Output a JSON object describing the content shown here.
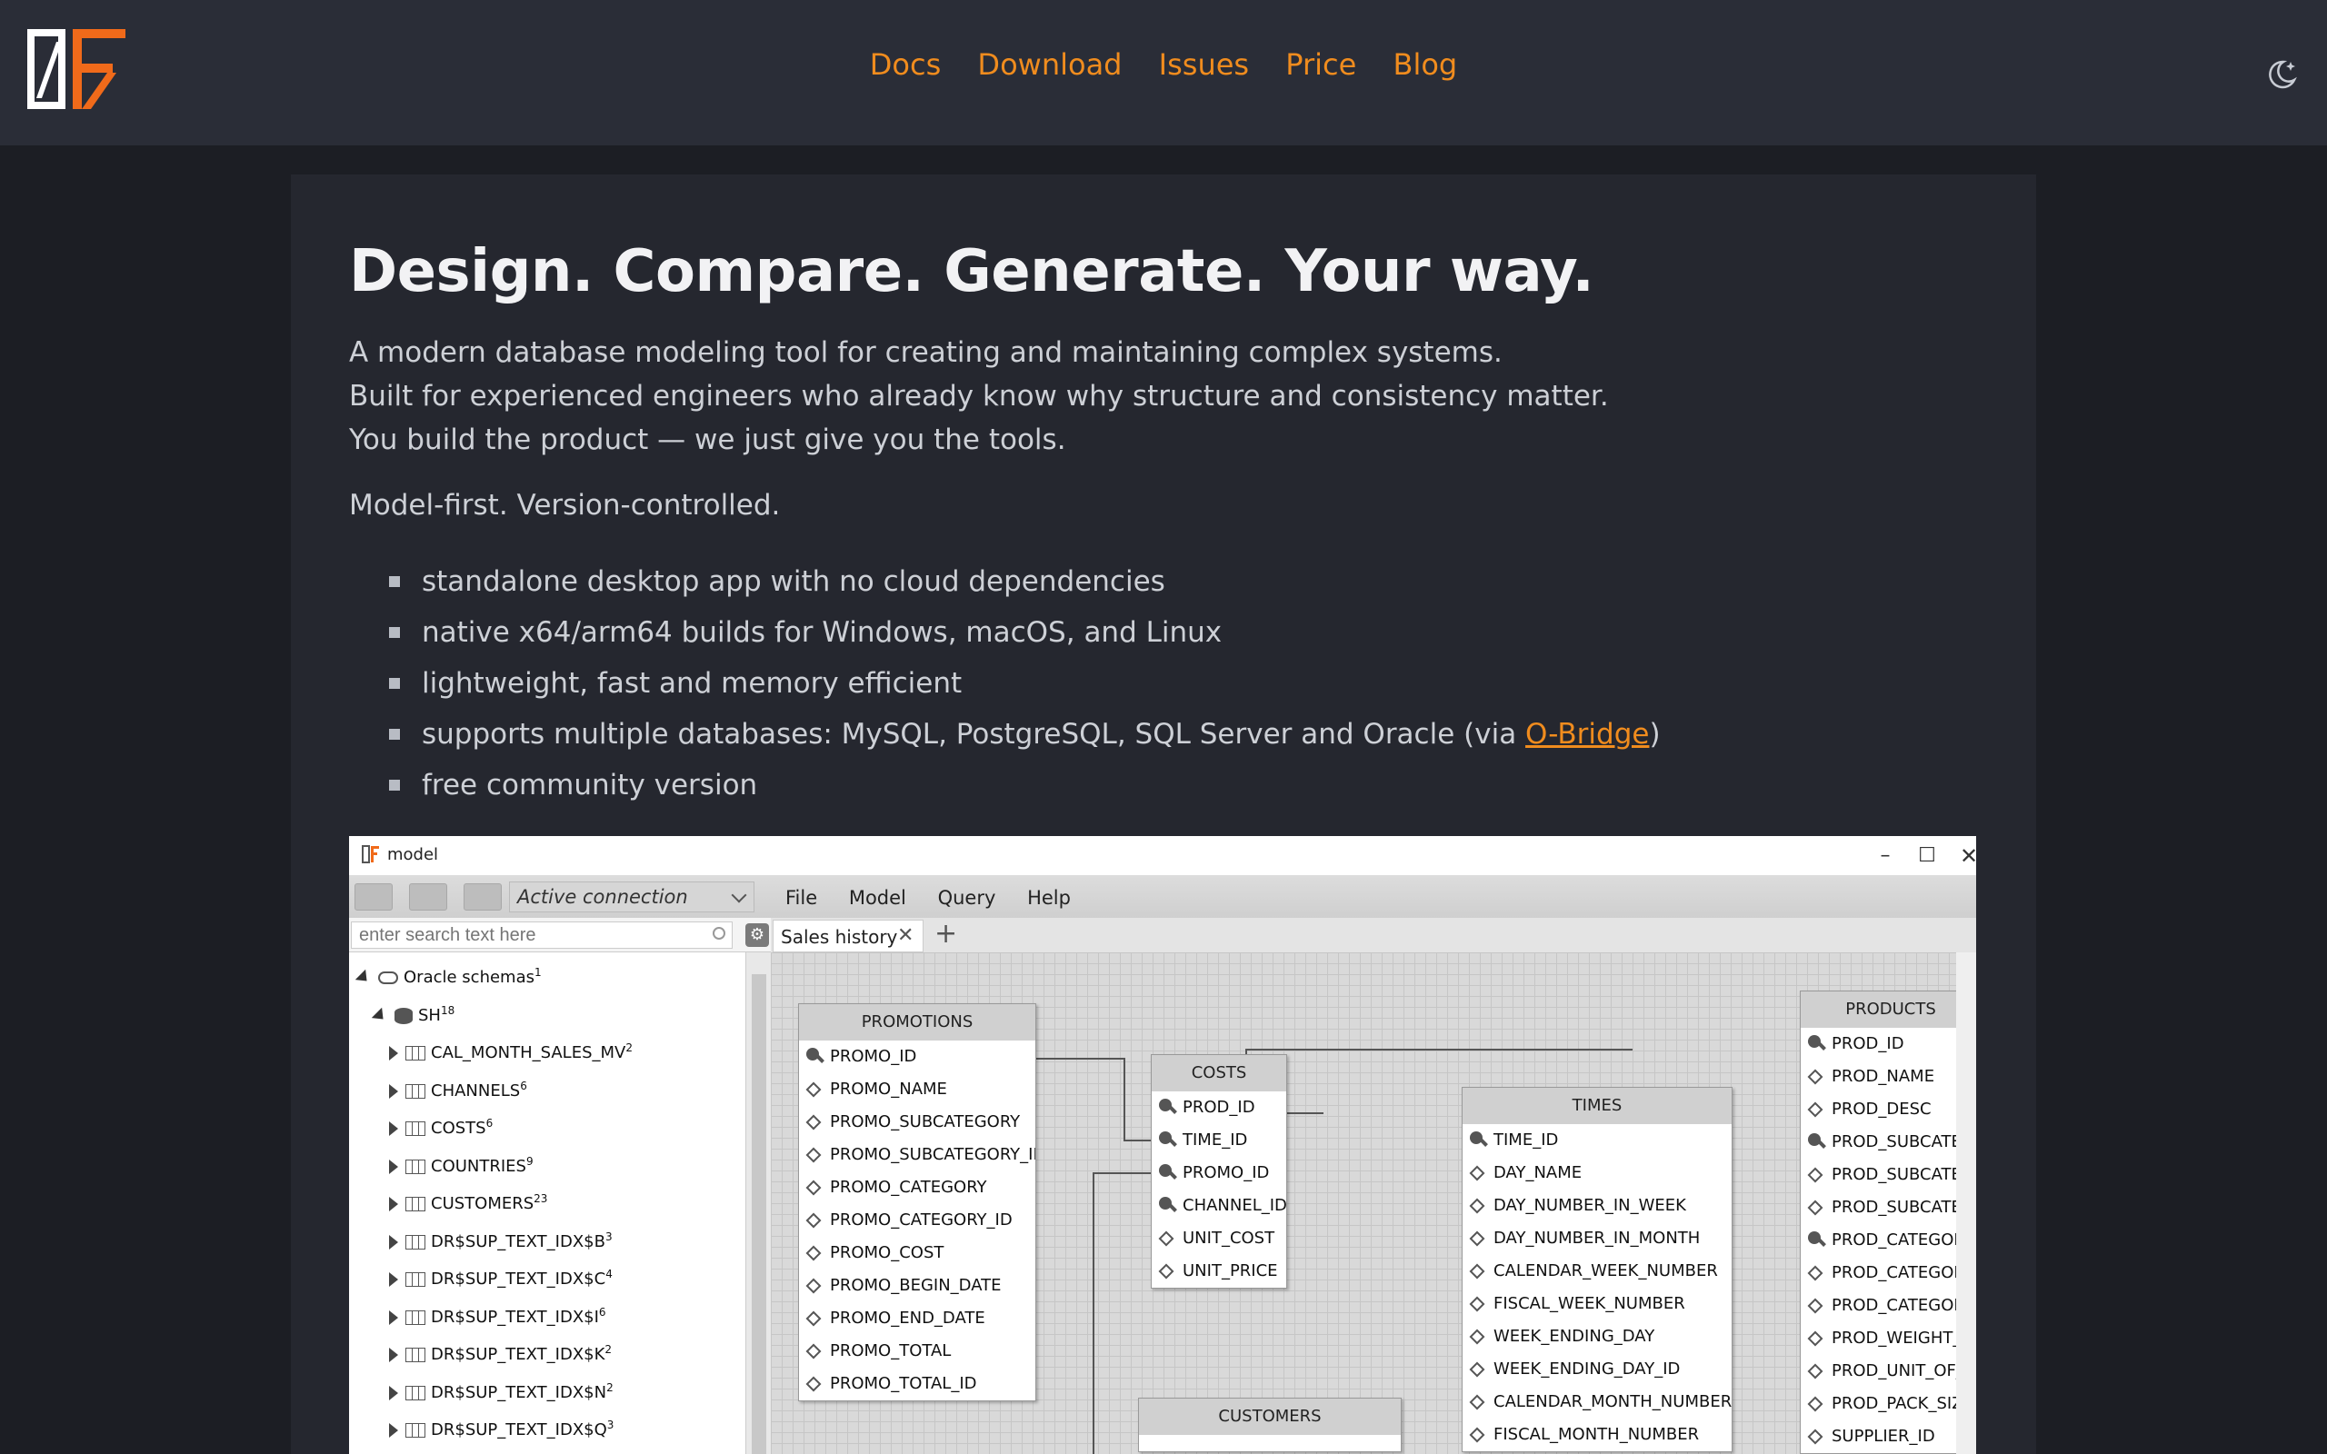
{
  "header": {
    "logo_text": "0F",
    "nav": [
      "Docs",
      "Download",
      "Issues",
      "Price",
      "Blog"
    ],
    "theme_icon": "moon-sparkle-icon"
  },
  "hero": {
    "headline": "Design. Compare. Generate. Your way.",
    "intro": [
      "A modern database modeling tool for creating and maintaining complex systems.",
      "Built for experienced engineers who already know why structure and consistency matter.",
      "You build the product — we just give you the tools."
    ],
    "tagline": "Model-first. Version-controlled.",
    "features": [
      "standalone desktop app with no cloud dependencies",
      "native x64/arm64 builds for Windows, macOS, and Linux",
      "lightweight, fast and memory efficient",
      "supports multiple databases: MySQL, PostgreSQL, SQL Server and Oracle (via ",
      "free community version"
    ],
    "feature_link": "O-Bridge",
    "feature_link_suffix": ")"
  },
  "app": {
    "title": "model",
    "connection": "Active connection",
    "menu": [
      "File",
      "Model",
      "Query",
      "Help"
    ],
    "search_placeholder": "enter search text here",
    "tab": "Sales history",
    "tree": [
      {
        "label": "Oracle schemas",
        "count": "1",
        "level": 0,
        "type": "schemas"
      },
      {
        "label": "SH",
        "count": "18",
        "level": 1,
        "type": "db"
      },
      {
        "label": "CAL_MONTH_SALES_MV",
        "count": "2",
        "level": 2,
        "type": "table"
      },
      {
        "label": "CHANNELS",
        "count": "6",
        "level": 2,
        "type": "table"
      },
      {
        "label": "COSTS",
        "count": "6",
        "level": 2,
        "type": "table"
      },
      {
        "label": "COUNTRIES",
        "count": "9",
        "level": 2,
        "type": "table"
      },
      {
        "label": "CUSTOMERS",
        "count": "23",
        "level": 2,
        "type": "table"
      },
      {
        "label": "DR$SUP_TEXT_IDX$B",
        "count": "3",
        "level": 2,
        "type": "table"
      },
      {
        "label": "DR$SUP_TEXT_IDX$C",
        "count": "4",
        "level": 2,
        "type": "table"
      },
      {
        "label": "DR$SUP_TEXT_IDX$I",
        "count": "6",
        "level": 2,
        "type": "table"
      },
      {
        "label": "DR$SUP_TEXT_IDX$K",
        "count": "2",
        "level": 2,
        "type": "table"
      },
      {
        "label": "DR$SUP_TEXT_IDX$N",
        "count": "2",
        "level": 2,
        "type": "table"
      },
      {
        "label": "DR$SUP_TEXT_IDX$Q",
        "count": "3",
        "level": 2,
        "type": "table"
      }
    ],
    "entities": {
      "promotions": {
        "title": "PROMOTIONS",
        "fields": [
          "PROMO_ID",
          "PROMO_NAME",
          "PROMO_SUBCATEGORY",
          "PROMO_SUBCATEGORY_ID",
          "PROMO_CATEGORY",
          "PROMO_CATEGORY_ID",
          "PROMO_COST",
          "PROMO_BEGIN_DATE",
          "PROMO_END_DATE",
          "PROMO_TOTAL",
          "PROMO_TOTAL_ID"
        ]
      },
      "costs": {
        "title": "COSTS",
        "fields": [
          "PROD_ID",
          "TIME_ID",
          "PROMO_ID",
          "CHANNEL_ID",
          "UNIT_COST",
          "UNIT_PRICE"
        ]
      },
      "times": {
        "title": "TIMES",
        "fields": [
          "TIME_ID",
          "DAY_NAME",
          "DAY_NUMBER_IN_WEEK",
          "DAY_NUMBER_IN_MONTH",
          "CALENDAR_WEEK_NUMBER",
          "FISCAL_WEEK_NUMBER",
          "WEEK_ENDING_DAY",
          "WEEK_ENDING_DAY_ID",
          "CALENDAR_MONTH_NUMBER",
          "FISCAL_MONTH_NUMBER"
        ]
      },
      "products": {
        "title": "PRODUCTS",
        "fields": [
          "PROD_ID",
          "PROD_NAME",
          "PROD_DESC",
          "PROD_SUBCATEGOF",
          "PROD_SUBCATEGOF",
          "PROD_SUBCATEGOF",
          "PROD_CATEGORY",
          "PROD_CATEGORY_ID",
          "PROD_CATEGORY_D",
          "PROD_WEIGHT_CLA",
          "PROD_UNIT_OF_ME",
          "PROD_PACK_SIZE",
          "SUPPLIER_ID"
        ]
      },
      "customers": {
        "title": "CUSTOMERS",
        "fields": []
      }
    }
  }
}
